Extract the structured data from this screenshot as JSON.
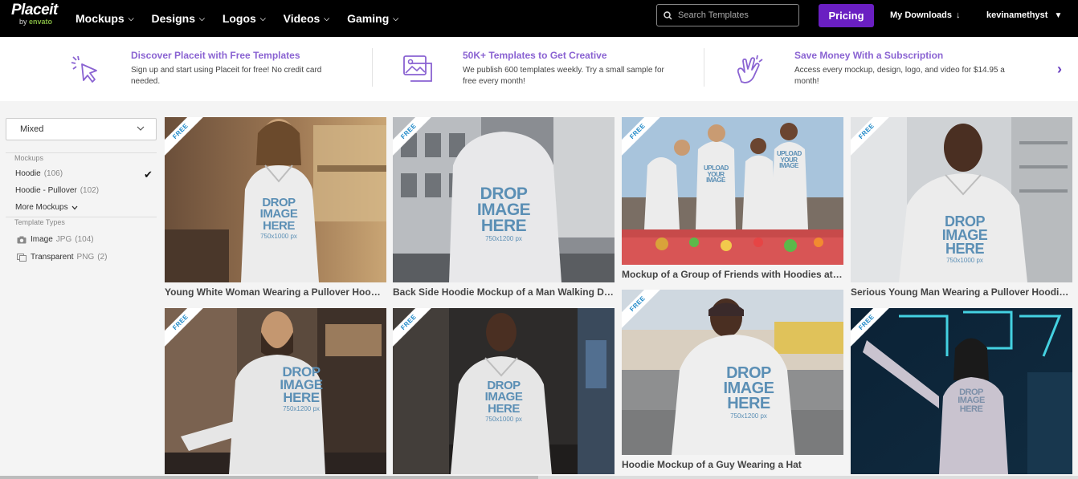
{
  "nav": {
    "logo_word": "Placeit",
    "logo_by": "by",
    "logo_brand": "envato",
    "menu": [
      {
        "label": "Mockups"
      },
      {
        "label": "Designs"
      },
      {
        "label": "Logos"
      },
      {
        "label": "Videos"
      },
      {
        "label": "Gaming"
      }
    ],
    "search_placeholder": "Search Templates",
    "pricing_label": "Pricing",
    "downloads_label": "My Downloads",
    "username": "kevinamethyst"
  },
  "promo": [
    {
      "title": "Discover Placeit with Free Templates",
      "text": "Sign up and start using Placeit for free! No credit card needed.",
      "icon": "cursor-click-icon"
    },
    {
      "title": "50K+ Templates to Get Creative",
      "text": "We publish 600 templates weekly. Try a small sample for free every month!",
      "icon": "image-stack-icon"
    },
    {
      "title": "Save Money With a Subscription",
      "text": "Access every mockup, design, logo, and video for $14.95 a month!",
      "icon": "hand-snap-icon"
    }
  ],
  "sidebar": {
    "sort_value": "Mixed",
    "mockups_heading": "Mockups",
    "filters": [
      {
        "label": "Hoodie",
        "count": "(106)",
        "checked": true
      },
      {
        "label": "Hoodie - Pullover",
        "count": "(102)",
        "checked": false
      }
    ],
    "more_label": "More Mockups",
    "types_heading": "Template Types",
    "types": [
      {
        "label": "Image",
        "ext": "JPG",
        "count": "(104)",
        "icon": "camera-icon"
      },
      {
        "label": "Transparent",
        "ext": "PNG",
        "count": "(2)",
        "icon": "transparent-layers-icon"
      }
    ]
  },
  "cards": [
    {
      "caption": "Young White Woman Wearing a Pullover Hoodie ...",
      "badge": "FREE",
      "drop": [
        "DROP",
        "IMAGE",
        "HERE"
      ],
      "size": "750x1000 px"
    },
    {
      "caption": "Back Side Hoodie Mockup of a Man Walking Do...",
      "badge": "FREE",
      "drop": [
        "DROP",
        "IMAGE",
        "HERE"
      ],
      "size": "750x1200 px"
    },
    {
      "caption": "Mockup of a Group of Friends with Hoodies at a ...",
      "badge": "FREE",
      "drop": [
        "UPLOAD",
        "YOUR",
        "IMAGE"
      ],
      "size": ""
    },
    {
      "caption": "Serious Young Man Wearing a Pullover Hoodie O...",
      "badge": "FREE",
      "drop": [
        "DROP",
        "IMAGE",
        "HERE"
      ],
      "size": "750x1000 px"
    },
    {
      "caption": "",
      "badge": "FREE",
      "drop": [
        "DROP",
        "IMAGE",
        "HERE"
      ],
      "size": "750x1200 px"
    },
    {
      "caption": "",
      "badge": "FREE",
      "drop": [
        "DROP",
        "IMAGE",
        "HERE"
      ],
      "size": "750x1000 px"
    },
    {
      "caption": "Hoodie Mockup of a Guy Wearing a Hat",
      "badge": "FREE",
      "drop": [
        "DROP",
        "IMAGE",
        "HERE"
      ],
      "size": "750x1200 px"
    },
    {
      "caption": "",
      "badge": "FREE",
      "drop": [
        "DROP",
        "IMAGE",
        "HERE"
      ],
      "size": ""
    }
  ],
  "colors": {
    "accent": "#6a1fc2",
    "promo_title": "#8a63d2",
    "free_badge": "#1e88c8",
    "drop_text": "#5b8fb5"
  }
}
